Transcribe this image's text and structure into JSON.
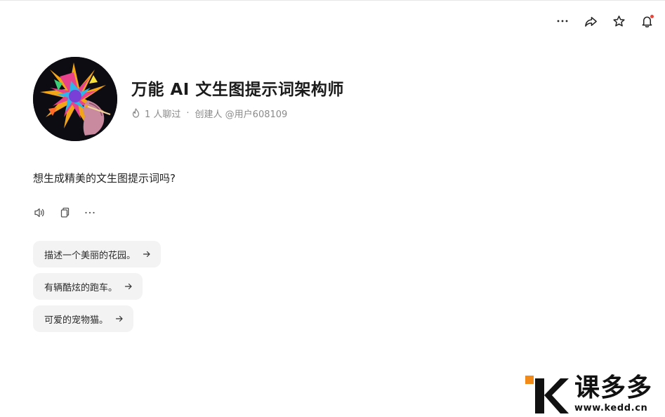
{
  "top_actions": {
    "more_icon": "more-horizontal-icon",
    "share_icon": "share-icon",
    "favorite_icon": "star-icon",
    "notification_icon": "bell-icon",
    "notification_dot_color": "#e8463b"
  },
  "bot": {
    "name": "万能 AI 文生图提示词架构师",
    "chat_count": "1 人聊过",
    "separator": "·",
    "creator": "创建人 @用户608109"
  },
  "message": {
    "greeting": "想生成精美的文生图提示词吗?",
    "tools": [
      "speaker-icon",
      "copy-icon",
      "more-horizontal-icon"
    ]
  },
  "suggestions": [
    {
      "label": "描述一个美丽的花园。"
    },
    {
      "label": "有辆酷炫的跑车。"
    },
    {
      "label": "可爱的宠物猫。"
    }
  ],
  "watermark": {
    "brand": "课多多",
    "url": "www.kedd.cn",
    "accent_color": "#f28a1a"
  }
}
